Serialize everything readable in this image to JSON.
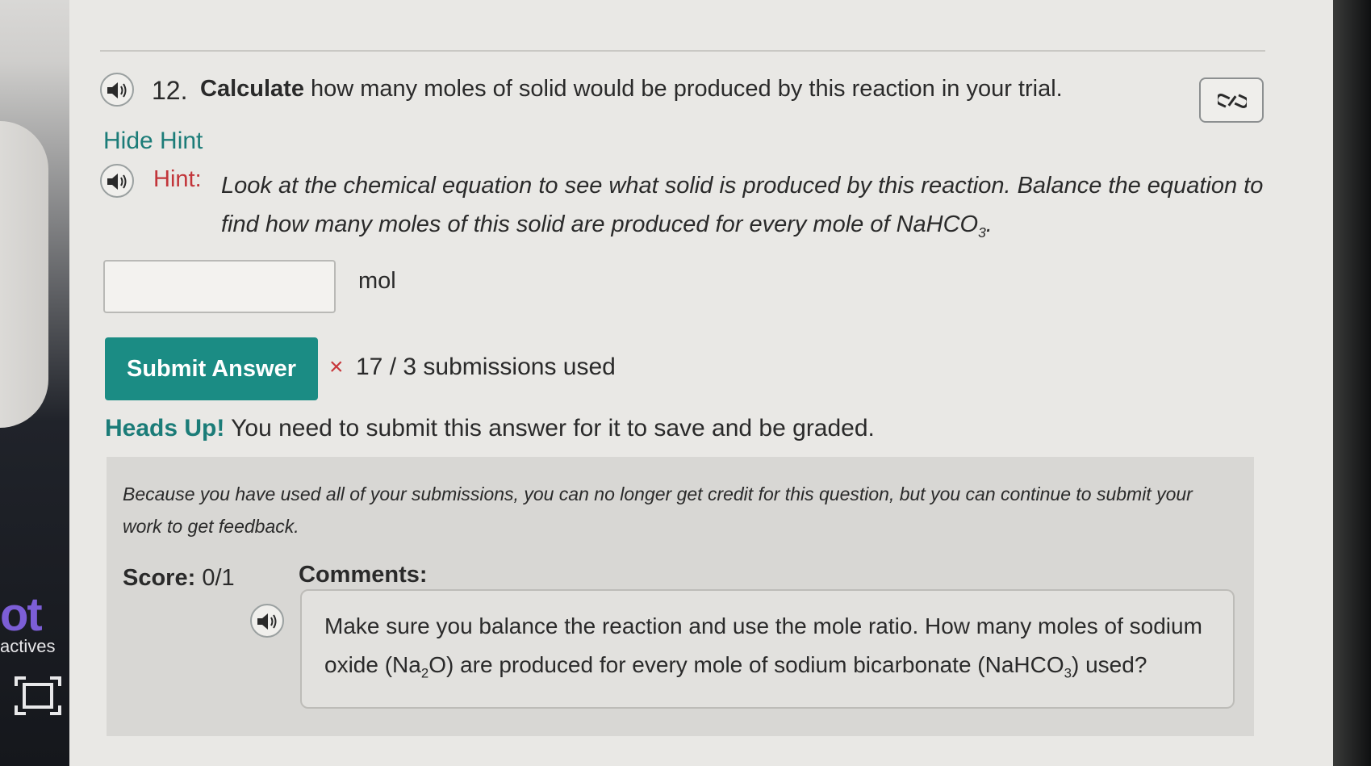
{
  "left_panel": {
    "brand_fragment": "ot",
    "label": "actives"
  },
  "question": {
    "number": "12.",
    "emphasis": "Calculate",
    "text_rest": " how many moles of solid would be produced by this reaction in your trial."
  },
  "hint": {
    "toggle_label": "Hide Hint",
    "label": "Hint:",
    "text": "Look at the chemical equation to see what solid is produced by this reaction. Balance the equation to find how many moles of this solid are produced for every mole of NaHCO",
    "text_subscript": "3",
    "text_end": "."
  },
  "answer": {
    "value": "",
    "unit": "mol"
  },
  "submit": {
    "label": "Submit Answer",
    "status_icon": "×",
    "status_text": "17 / 3 submissions used"
  },
  "heads_up": {
    "label": "Heads Up!",
    "text": " You need to submit this answer for it to save and be graded."
  },
  "feedback": {
    "notice": "Because you have used all of your submissions, you can no longer get credit for this question, but you can continue to submit your work to get feedback.",
    "score_label": "Score:",
    "score_value": " 0/1",
    "comments_label": "Comments:",
    "comment_part1": "Make sure you balance the reaction and use the mole ratio. How many moles of sodium oxide (Na",
    "comment_sub1": "2",
    "comment_part2": "O) are produced for every mole of sodium bicarbonate (NaHCO",
    "comment_sub2": "3",
    "comment_part3": ") used?"
  },
  "icons": {
    "speaker": "speaker-icon",
    "link": "link-icon",
    "x": "x-icon",
    "frame": "fullscreen-icon"
  },
  "colors": {
    "teal": "#1b8c84",
    "hint_red": "#c2353a",
    "link_teal": "#1b7c78"
  }
}
